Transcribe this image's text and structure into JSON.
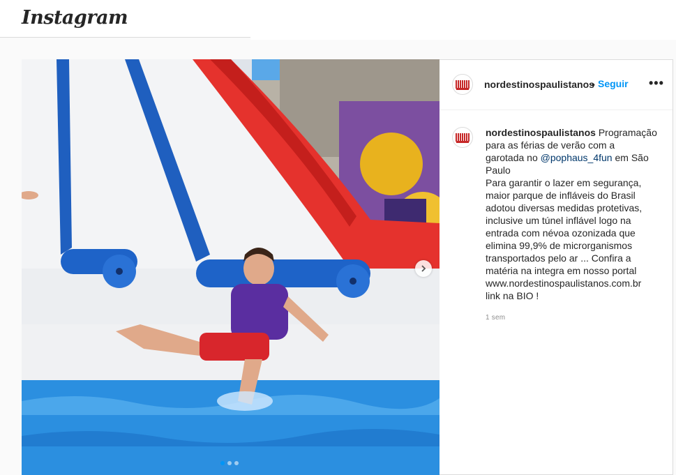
{
  "app": {
    "logo": "Instagram"
  },
  "post": {
    "username": "nordestinospaulistanos",
    "separator": "•",
    "follow_label": "Seguir",
    "more_label": "•••",
    "caption": {
      "username": "nordestinospaulistanos",
      "first_line": "Programação",
      "lines": [
        "para as férias de verão com a",
        "garotada no ",
        "Paulo",
        "Para garantir o lazer em segurança,",
        "maior parque de infláveis do Brasil",
        "adotou diversas medidas protetivas,",
        "inclusive um túnel inflável logo na",
        "entrada com névoa ozonizada que",
        "elimina 99,9% de microrganismos",
        "transportados pelo ar ... Confira a",
        "matéria na integra em nosso portal",
        "www.nordestinospaulistanos.com.br",
        "link na BIO !"
      ],
      "mention": "@pophaus_4fun",
      "mention_suffix": " em São"
    },
    "time_ago": "1 sem",
    "carousel": {
      "current": 1,
      "total": 3
    }
  },
  "colors": {
    "accent": "#0095f6",
    "border": "#dbdbdb",
    "muted": "#8e8e8e"
  },
  "icons": {
    "next": "chevron-right-icon",
    "more": "more-horizontal-icon"
  }
}
